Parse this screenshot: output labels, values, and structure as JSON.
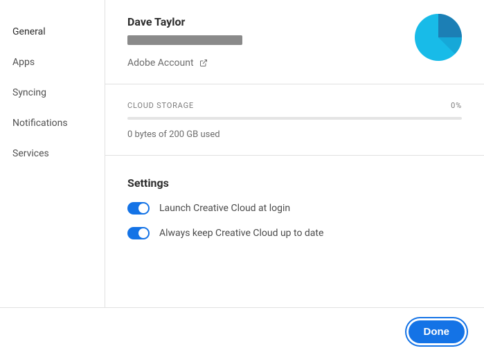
{
  "sidebar": {
    "items": [
      {
        "label": "General",
        "active": true
      },
      {
        "label": "Apps",
        "active": false
      },
      {
        "label": "Syncing",
        "active": false
      },
      {
        "label": "Notifications",
        "active": false
      },
      {
        "label": "Services",
        "active": false
      }
    ]
  },
  "account": {
    "user_name": "Dave Taylor",
    "link_label": "Adobe Account"
  },
  "storage": {
    "heading": "CLOUD STORAGE",
    "percent_label": "0%",
    "usage_text": "0 bytes of 200 GB used"
  },
  "settings": {
    "title": "Settings",
    "toggles": [
      {
        "label": "Launch Creative Cloud at login",
        "on": true
      },
      {
        "label": "Always keep Creative Cloud up to date",
        "on": true
      }
    ]
  },
  "footer": {
    "done_label": "Done"
  },
  "colors": {
    "accent": "#1473e6",
    "avatar_primary": "#18bbe8",
    "avatar_secondary": "#1c7fb5"
  }
}
